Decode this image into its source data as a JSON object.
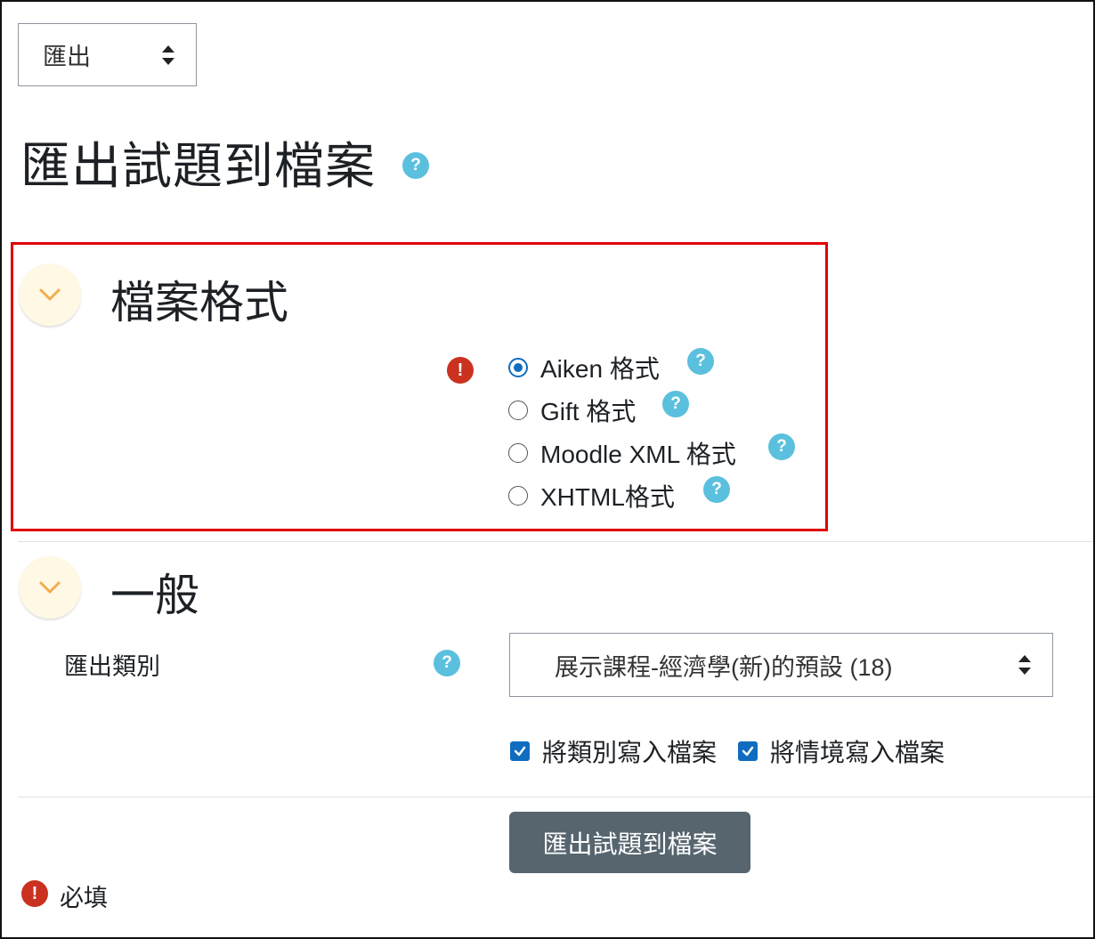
{
  "action_select": {
    "value": "匯出"
  },
  "page_title": "匯出試題到檔案",
  "help_glyph": "?",
  "required_glyph": "!",
  "section_format": {
    "title": "檔案格式",
    "options": [
      {
        "label": "Aiken 格式",
        "checked": true
      },
      {
        "label": "Gift 格式",
        "checked": false
      },
      {
        "label": "Moodle XML 格式",
        "checked": false
      },
      {
        "label": "XHTML格式",
        "checked": false
      }
    ]
  },
  "section_general": {
    "title": "一般",
    "category_label": "匯出類別",
    "category_value": "展示課程-經濟學(新)的預設 (18)",
    "checkbox_category": "將類別寫入檔案",
    "checkbox_context": "將情境寫入檔案"
  },
  "submit_label": "匯出試題到檔案",
  "required_note": "必填",
  "colors": {
    "help": "#5bc0de",
    "required": "#ca3120",
    "highlight_border": "#e00000",
    "primary": "#0f6cbf",
    "submit_bg": "#56656e",
    "toggle_bg": "#fff8e5",
    "chevron": "#f0ad4e"
  }
}
